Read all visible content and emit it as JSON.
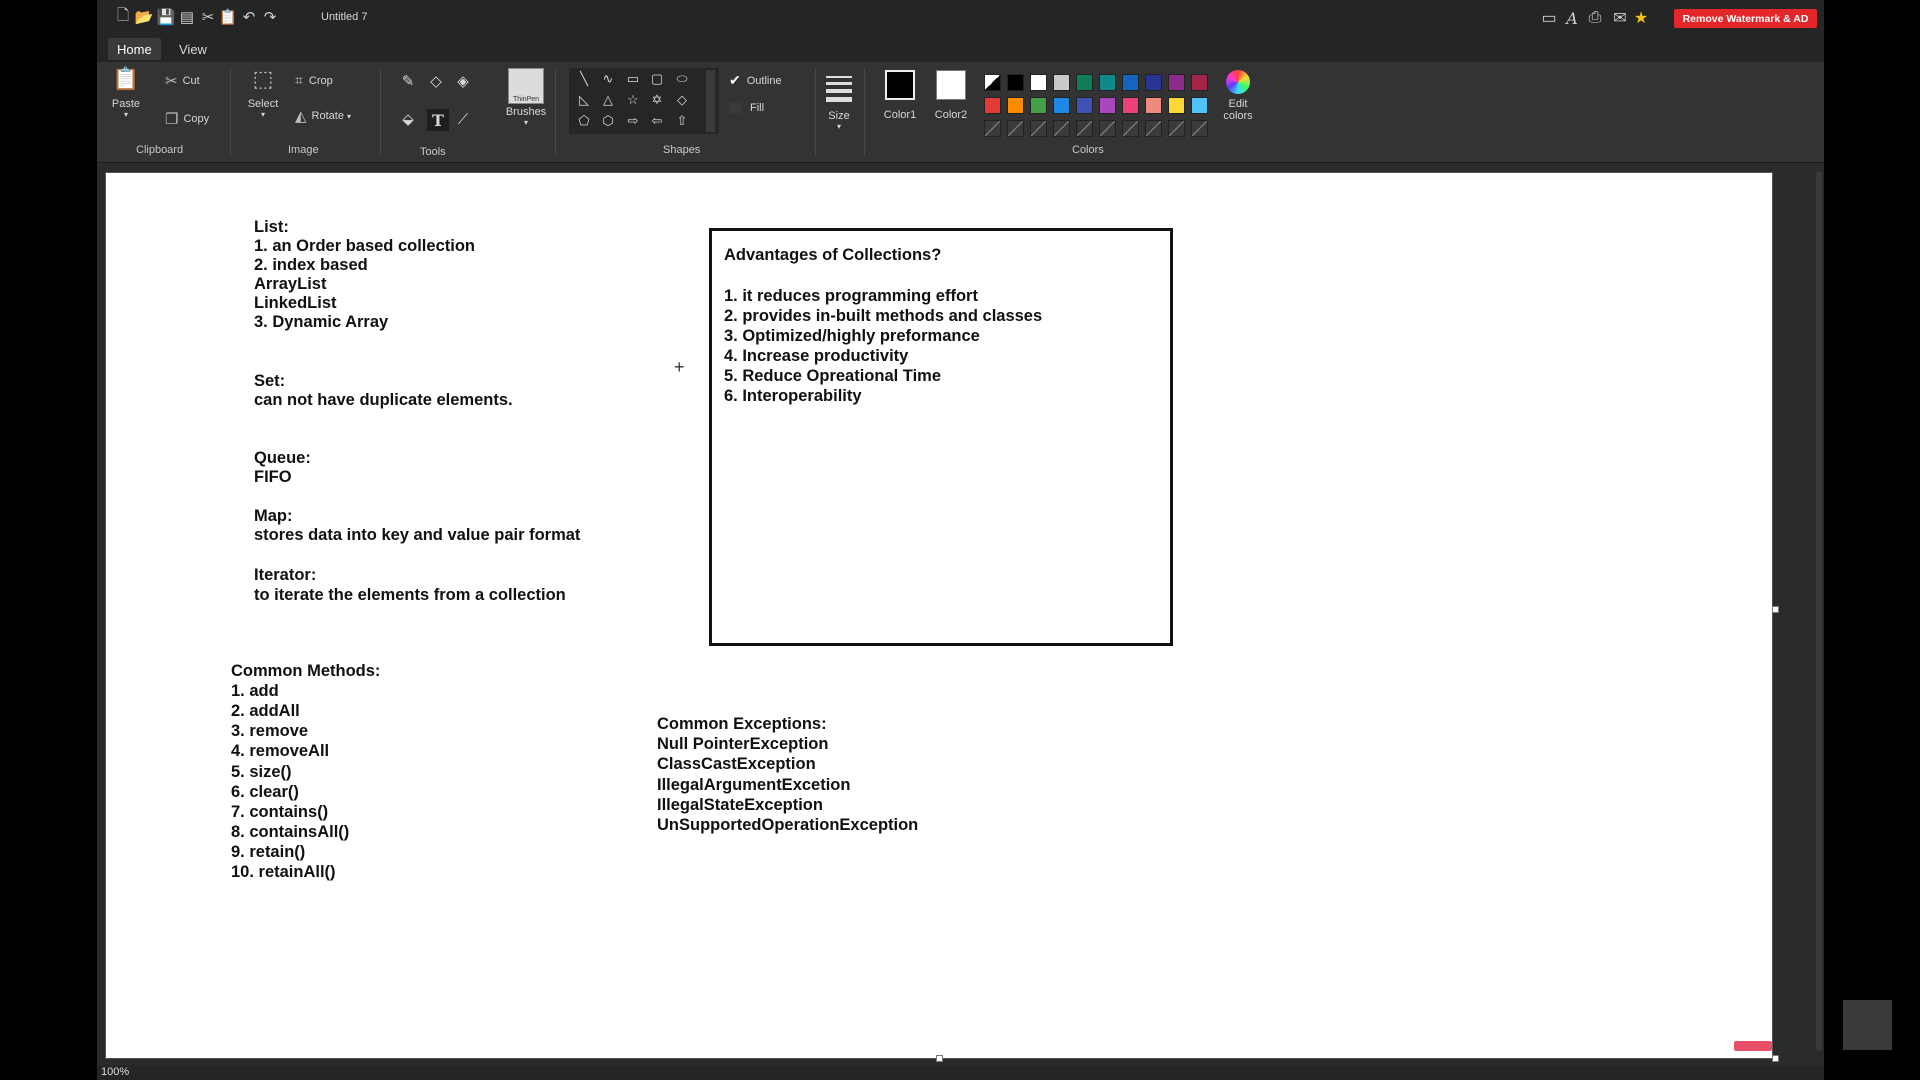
{
  "window": {
    "title": "Untitled 7",
    "remove_watermark_label": "Remove Watermark & AD"
  },
  "tabs": [
    "Home",
    "View"
  ],
  "ribbon": {
    "clipboard": {
      "paste": "Paste",
      "cut": "Cut",
      "copy": "Copy",
      "group": "Clipboard"
    },
    "image": {
      "select": "Select",
      "crop": "Crop",
      "rotate": "Rotate",
      "group": "Image"
    },
    "tools": {
      "group": "Tools"
    },
    "brushes": {
      "label": "Brushes",
      "thumb_text": "ThinPen"
    },
    "shapes": {
      "group": "Shapes",
      "outline": "Outline",
      "fill": "Fill"
    },
    "size": {
      "label": "Size"
    },
    "colors": {
      "color1": "Color1",
      "color2": "Color2",
      "edit": "Edit colors",
      "group": "Colors",
      "color1_value": "#000000",
      "color2_value": "#ffffff",
      "row1": [
        "#000000",
        "#ffffff",
        "#c8c8c8",
        "#107c5a",
        "#0f8a8a",
        "#1565c0",
        "#283593",
        "#8e2b8a",
        "#a5244a"
      ],
      "row2": [
        "#e53935",
        "#fb8c00",
        "#43a047",
        "#1e88e5",
        "#3f51b5",
        "#ab47bc",
        "#ec407a",
        "#ef8a80",
        "#fdd835",
        "#4fc3f7"
      ]
    }
  },
  "canvas": {
    "list_title": "List:",
    "list_items": [
      "1. an Order based collection",
      "2. index based",
      "ArrayList",
      "LinkedList",
      "3. Dynamic Array"
    ],
    "set_title": "Set:",
    "set_desc": "can not have duplicate elements.",
    "queue_title": "Queue:",
    "queue_desc": "FIFO",
    "map_title": "Map:",
    "map_desc": "stores data into key and value pair format",
    "iterator_title": "Iterator:",
    "iterator_desc": "to iterate the elements from a collection",
    "methods_title": "Common Methods:",
    "methods": [
      "1. add",
      "2. addAll",
      "3. remove",
      "4. removeAll",
      "5. size()",
      "6. clear()",
      "7. contains()",
      "8. containsAll()",
      "9. retain()",
      "10. retainAll()"
    ],
    "advantages_title": "Advantages of Collections?",
    "advantages": [
      "1. it reduces programming effort",
      "2. provides in-built methods and classes",
      "3. Optimized/highly preformance",
      "4. Increase productivity",
      "5. Reduce Opreational Time",
      "6. Interoperability"
    ],
    "exceptions_title": "Common Exceptions:",
    "exceptions": [
      "Null PointerException",
      "ClassCastException",
      "IllegalArgumentExcetion",
      "IllegalStateException",
      "UnSupportedOperationException"
    ]
  },
  "status": {
    "zoom": "100%"
  }
}
